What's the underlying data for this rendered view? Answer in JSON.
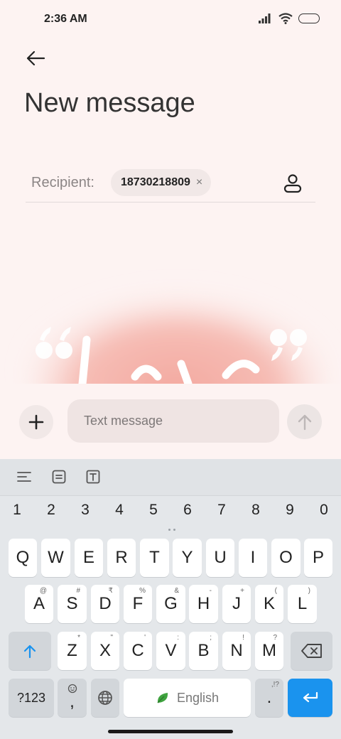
{
  "status_bar": {
    "time": "2:36 AM"
  },
  "header": {
    "title": "New message"
  },
  "recipient": {
    "label": "Recipient:",
    "chip_number": "18730218809",
    "chip_remove": "×"
  },
  "compose": {
    "placeholder": "Text message",
    "plus": "+"
  },
  "keyboard": {
    "numbers": [
      "1",
      "2",
      "3",
      "4",
      "5",
      "6",
      "7",
      "8",
      "9",
      "0"
    ],
    "row1": [
      "Q",
      "W",
      "E",
      "R",
      "T",
      "Y",
      "U",
      "I",
      "O",
      "P"
    ],
    "row2": [
      {
        "key": "A",
        "hint": "@"
      },
      {
        "key": "S",
        "hint": "#"
      },
      {
        "key": "D",
        "hint": "₹"
      },
      {
        "key": "F",
        "hint": "%"
      },
      {
        "key": "G",
        "hint": "&"
      },
      {
        "key": "H",
        "hint": "-"
      },
      {
        "key": "J",
        "hint": "+"
      },
      {
        "key": "K",
        "hint": "("
      },
      {
        "key": "L",
        "hint": ")"
      }
    ],
    "row3": [
      {
        "key": "Z",
        "hint": "*"
      },
      {
        "key": "X",
        "hint": "\""
      },
      {
        "key": "C",
        "hint": "'"
      },
      {
        "key": "V",
        "hint": ":"
      },
      {
        "key": "B",
        "hint": ";"
      },
      {
        "key": "N",
        "hint": "!"
      },
      {
        "key": "M",
        "hint": "?"
      }
    ],
    "symbols_label": "?123",
    "comma": ",",
    "space_label": "English",
    "period": ".",
    "period_hint": ",!?"
  },
  "colors": {
    "accent": "#1a93ee",
    "background": "#fdf3f2",
    "keyboard": "#e4e7ea",
    "love_card": "#f5b5ad"
  },
  "icons": [
    "back-arrow-icon",
    "contact-icon",
    "plus-icon",
    "send-arrow-icon",
    "align-icon",
    "clipboard-icon",
    "text-box-icon",
    "shift-icon",
    "backspace-icon",
    "emoji-icon",
    "globe-icon",
    "leaf-icon",
    "enter-icon"
  ]
}
